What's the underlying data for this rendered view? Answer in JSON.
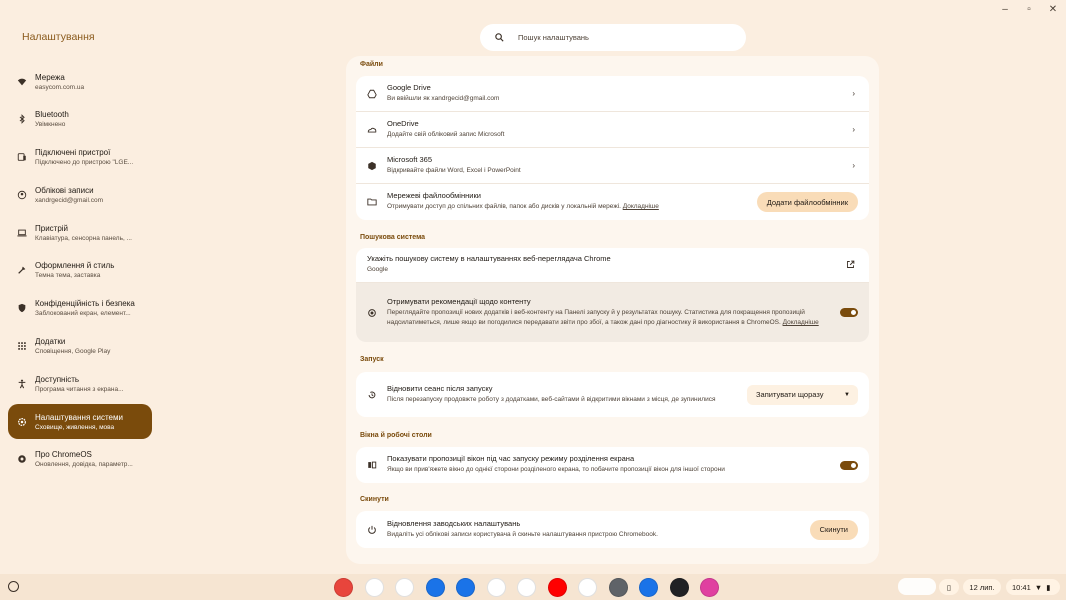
{
  "window": {
    "title": "Налаштування"
  },
  "search": {
    "placeholder": "Пошук налаштувань"
  },
  "sidebar": {
    "items": [
      {
        "title": "Мережа",
        "subtitle": "easycom.com.ua",
        "icon": "wifi-icon"
      },
      {
        "title": "Bluetooth",
        "subtitle": "Увімкнено",
        "icon": "bluetooth-icon"
      },
      {
        "title": "Підключені пристрої",
        "subtitle": "Підключено до пристрою \"LGE...",
        "icon": "phone-link-icon"
      },
      {
        "title": "Облікові записи",
        "subtitle": "xandrgecid@gmail.com",
        "icon": "account-icon"
      },
      {
        "title": "Пристрій",
        "subtitle": "Клавіатура, сенсорна панель, ...",
        "icon": "laptop-icon"
      },
      {
        "title": "Оформлення й стиль",
        "subtitle": "Темна тема, заставка",
        "icon": "palette-icon"
      },
      {
        "title": "Конфіденційність і безпека",
        "subtitle": "Заблокований екран, елемент...",
        "icon": "shield-icon"
      },
      {
        "title": "Додатки",
        "subtitle": "Сповіщення, Google Play",
        "icon": "apps-grid-icon"
      },
      {
        "title": "Доступність",
        "subtitle": "Програма читання з екрана...",
        "icon": "accessibility-icon"
      },
      {
        "title": "Налаштування системи",
        "subtitle": "Сховище, живлення, мова",
        "icon": "system-settings-icon",
        "active": true
      },
      {
        "title": "Про ChromeOS",
        "subtitle": "Оновлення, довідка, параметр...",
        "icon": "chromeos-icon"
      }
    ]
  },
  "sections": {
    "files": {
      "title": "Файли",
      "rows": [
        {
          "title": "Google Drive",
          "subtitle": "Ви ввійшли як xandrgecid@gmail.com"
        },
        {
          "title": "OneDrive",
          "subtitle": "Додайте свій обліковий запис Microsoft"
        },
        {
          "title": "Microsoft 365",
          "subtitle": "Відкривайте файли Word, Excel і PowerPoint"
        },
        {
          "title": "Мережеві файлообмінники",
          "subtitle": "Отримувати доступ до спільних файлів, папок або дисків у локальній мережі.",
          "link": "Докладніше",
          "button": "Додати файлообмінник"
        }
      ]
    },
    "search_engine": {
      "title": "Пошукова система",
      "rows": [
        {
          "title": "Укажіть пошукову систему в налаштуваннях веб-переглядача Chrome",
          "subtitle": "Google"
        },
        {
          "title": "Отримувати рекомендації щодо контенту",
          "subtitle": "Переглядайте пропозиції нових додатків і веб-контенту на Панелі запуску й у результатах пошуку. Статистика для покращення пропозицій надсилатиметься, лише якщо ви погодилися передавати звіти про збої, а також дані про діагностику й використання в ChromeOS.",
          "link": "Докладніше",
          "toggle": "on"
        }
      ]
    },
    "startup": {
      "title": "Запуск",
      "rows": [
        {
          "title": "Відновити сеанс після запуску",
          "subtitle": "Після перезапуску продовжте роботу з додатками, веб-сайтами й відкритими вікнами з місця, де зупинилися",
          "select": "Запитувати щоразу"
        }
      ]
    },
    "windows": {
      "title": "Вікна й робочі столи",
      "rows": [
        {
          "title": "Показувати пропозиції вікон під час запуску режиму розділення екрана",
          "subtitle": "Якщо ви прив'яжете вікно до однієї сторони розділеного екрана, то побачите пропозиції вікон для іншої сторони",
          "toggle": "on"
        }
      ]
    },
    "reset": {
      "title": "Скинути",
      "rows": [
        {
          "title": "Відновлення заводських налаштувань",
          "subtitle": "Видаліть усі облікові записи користувача й скиньте налаштування пристрою Chromebook.",
          "button": "Скинути"
        }
      ]
    }
  },
  "shelf": {
    "date": "12 лип.",
    "time": "10:41",
    "apps": [
      {
        "name": "chrome-app",
        "color": "#e8453c"
      },
      {
        "name": "gmail-app",
        "color": "#ffffff"
      },
      {
        "name": "docs-app",
        "color": "#ffffff"
      },
      {
        "name": "files-app",
        "color": "#1a73e8"
      },
      {
        "name": "messages-app",
        "color": "#1a73e8"
      },
      {
        "name": "meet-app",
        "color": "#ffffff"
      },
      {
        "name": "play-store-app",
        "color": "#ffffff"
      },
      {
        "name": "youtube-app",
        "color": "#ff0000"
      },
      {
        "name": "photos-app",
        "color": "#ffffff"
      },
      {
        "name": "settings-app",
        "color": "#5f6368"
      },
      {
        "name": "custom-app-1",
        "color": "#1a73e8"
      },
      {
        "name": "custom-app-2",
        "color": "#202124"
      },
      {
        "name": "custom-app-3",
        "color": "#e040a0"
      }
    ]
  },
  "colors": {
    "accent": "#7a4b0c",
    "pill": "#f9dcb8",
    "background": "#fbeee0"
  }
}
